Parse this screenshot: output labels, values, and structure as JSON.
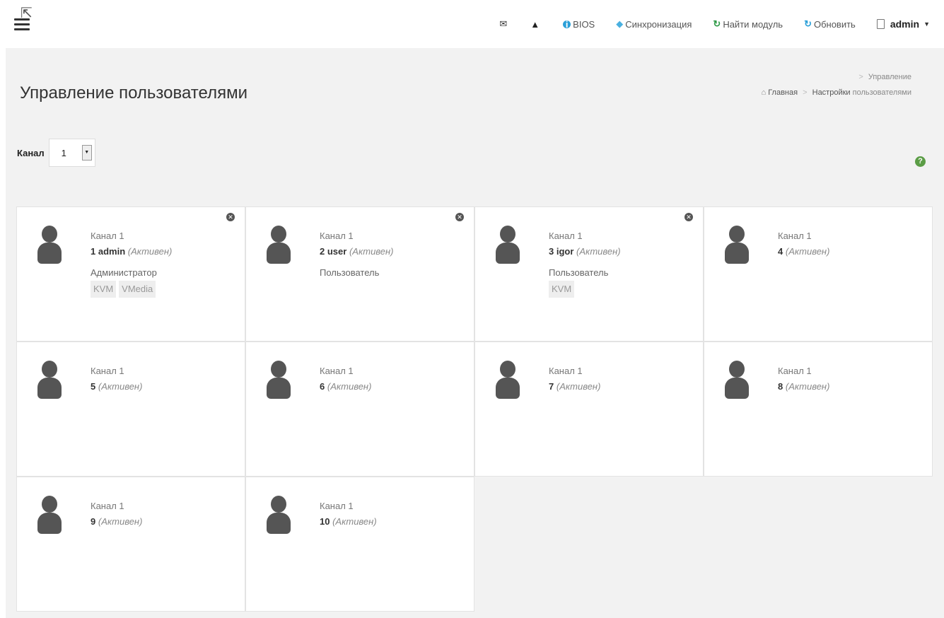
{
  "navbar": {
    "items": [
      {
        "icon": "envelope-icon",
        "label": ""
      },
      {
        "icon": "warning-icon",
        "label": ""
      },
      {
        "icon": "info-icon",
        "label": "BIOS"
      },
      {
        "icon": "diamond-icon",
        "label": "Синхронизация"
      },
      {
        "icon": "refresh-icon",
        "label": "Найти модуль"
      },
      {
        "icon": "refresh-icon",
        "label": "Обновить"
      }
    ],
    "user": "admin"
  },
  "page": {
    "title": "Управление пользователями"
  },
  "breadcrumb": {
    "home": "Главная",
    "settings": "Настройки",
    "current_line1": "Управление",
    "current_line2": "пользователями"
  },
  "channel": {
    "label": "Канал",
    "value": "1"
  },
  "users": [
    {
      "channel": "Канал 1",
      "id": "1",
      "name": "admin",
      "status": "(Активен)",
      "role": "Администратор",
      "tags": [
        "KVM",
        "VMedia"
      ],
      "removable": true
    },
    {
      "channel": "Канал 1",
      "id": "2",
      "name": "user",
      "status": "(Активен)",
      "role": "Пользователь",
      "tags": [],
      "removable": true
    },
    {
      "channel": "Канал 1",
      "id": "3",
      "name": "igor",
      "status": "(Активен)",
      "role": "Пользователь",
      "tags": [
        "KVM"
      ],
      "removable": true
    },
    {
      "channel": "Канал 1",
      "id": "4",
      "name": "",
      "status": "(Активен)",
      "role": "",
      "tags": [],
      "removable": false
    },
    {
      "channel": "Канал 1",
      "id": "5",
      "name": "",
      "status": "(Активен)",
      "role": "",
      "tags": [],
      "removable": false
    },
    {
      "channel": "Канал 1",
      "id": "6",
      "name": "",
      "status": "(Активен)",
      "role": "",
      "tags": [],
      "removable": false
    },
    {
      "channel": "Канал 1",
      "id": "7",
      "name": "",
      "status": "(Активен)",
      "role": "",
      "tags": [],
      "removable": false
    },
    {
      "channel": "Канал 1",
      "id": "8",
      "name": "",
      "status": "(Активен)",
      "role": "",
      "tags": [],
      "removable": false
    },
    {
      "channel": "Канал 1",
      "id": "9",
      "name": "",
      "status": "(Активен)",
      "role": "",
      "tags": [],
      "removable": false
    },
    {
      "channel": "Канал 1",
      "id": "10",
      "name": "",
      "status": "(Активен)",
      "role": "",
      "tags": [],
      "removable": false
    }
  ]
}
